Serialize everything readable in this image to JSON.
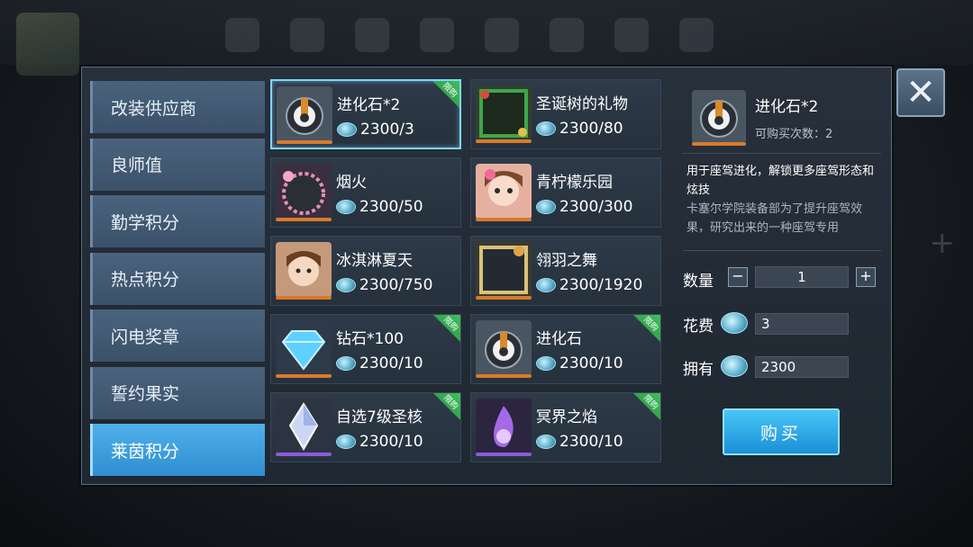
{
  "sidebar": {
    "categories": [
      "改装供应商",
      "良师值",
      "勤学积分",
      "热点积分",
      "闪电奖章",
      "誓约果实",
      "莱茵积分"
    ],
    "active_index": 6
  },
  "items": [
    {
      "name": "进化石*2",
      "price": "2300/3",
      "limited": true,
      "badge": "限购",
      "bar": "#d97a2a",
      "selected": true,
      "icon": "evolution-stone-icon"
    },
    {
      "name": "圣诞树的礼物",
      "price": "2300/80",
      "limited": false,
      "bar": "#d97a2a",
      "icon": "christmas-frame-icon"
    },
    {
      "name": "烟火",
      "price": "2300/50",
      "limited": false,
      "bar": "#d97a2a",
      "icon": "firework-frame-icon"
    },
    {
      "name": "青柠檬乐园",
      "price": "2300/300",
      "limited": false,
      "bar": "#d97a2a",
      "icon": "girl-avatar-icon"
    },
    {
      "name": "冰淇淋夏天",
      "price": "2300/750",
      "limited": false,
      "bar": "#d97a2a",
      "icon": "boy-avatar-icon"
    },
    {
      "name": "翎羽之舞",
      "price": "2300/1920",
      "limited": false,
      "bar": "#d97a2a",
      "icon": "feather-frame-icon"
    },
    {
      "name": "钻石*100",
      "price": "2300/10",
      "limited": true,
      "badge": "限购",
      "bar": "#d97a2a",
      "icon": "diamond-icon"
    },
    {
      "name": "进化石",
      "price": "2300/10",
      "limited": true,
      "badge": "限购",
      "bar": "#d97a2a",
      "icon": "evolution-stone-icon"
    },
    {
      "name": "自选7级圣核",
      "price": "2300/10",
      "limited": true,
      "badge": "限购",
      "bar": "#8e5ad9",
      "icon": "crystal-icon"
    },
    {
      "name": "冥界之焰",
      "price": "2300/10",
      "limited": true,
      "badge": "限购",
      "bar": "#8e5ad9",
      "icon": "purple-flame-icon"
    }
  ],
  "detail": {
    "name": "进化石*2",
    "limit_text": "可购买次数：2",
    "desc_main": "用于座驾进化，解锁更多座驾形态和炫技",
    "desc_sub": "卡塞尔学院装备部为了提升座驾效果，研究出来的一种座驾专用",
    "quantity_label": "数量",
    "quantity_value": "1",
    "cost_label": "花费",
    "cost_value": "3",
    "own_label": "拥有",
    "own_value": "2300",
    "buy_label": "购买",
    "minus": "−",
    "plus": "+"
  },
  "close_label": "✕",
  "colors": {
    "accent": "#2f8fd0",
    "limited": "#3fbf5d",
    "panel": "#27303b"
  }
}
